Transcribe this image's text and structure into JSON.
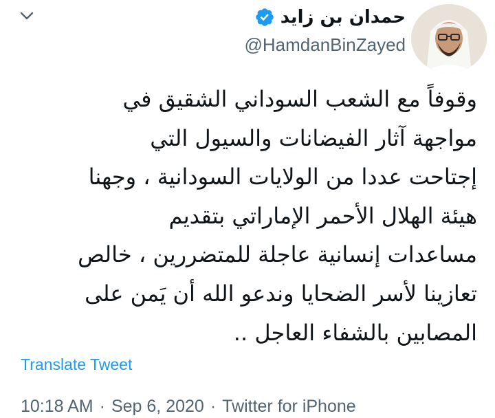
{
  "tweet": {
    "author": {
      "display_name": "حمدان بن زايد",
      "handle": "@HamdanBinZayed",
      "verified_icon": "verified-badge-icon",
      "avatar": "avatar-photo"
    },
    "menu_icon": "chevron-down-icon",
    "text": "وقوفاً مع الشعب السوداني الشقيق في\nمواجهة آثار الفيضانات والسيول التي\nإجتاحت عددا من الولايات السودانية ، وجهنا\nهيئة الهلال الأحمر الإماراتي بتقديم\nمساعدات إنسانية عاجلة للمتضررين ، خالص\nتعازينا لأسر الضحايا وندعو الله أن يَمن على\nالمصابين بالشفاء العاجل ..",
    "translate_label": "Translate Tweet",
    "time": "10:18 AM",
    "date": "Sep 6, 2020",
    "source": "Twitter for iPhone",
    "separator": "·"
  },
  "colors": {
    "text": "#0f1419",
    "secondary": "#536471",
    "link": "#1d9bf0",
    "verified": "#1d9bf0"
  }
}
